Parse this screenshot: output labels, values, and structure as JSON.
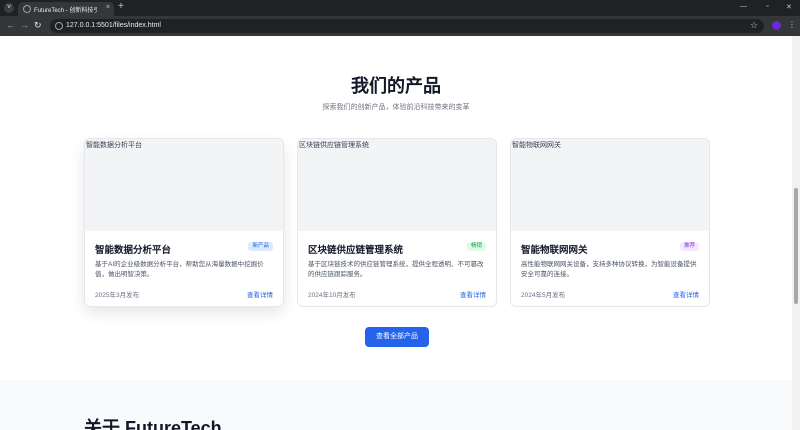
{
  "browser": {
    "tab_title": "FutureTech - 创新科技引领未来",
    "tab_close": "×",
    "new_tab": "+",
    "url": "127.0.0.1:5501/files/index.html",
    "back": "←",
    "forward": "→",
    "reload": "↻",
    "star": "☆",
    "menu": "⋮",
    "tab_menu": "˅",
    "minimize": "—",
    "maximize": "▫",
    "close": "✕"
  },
  "products": {
    "title": "我们的产品",
    "subtitle": "探索我们的创新产品，体验前沿科技带来的变革",
    "cards": [
      {
        "image_alt": "智能数据分析平台",
        "name": "智能数据分析平台",
        "badge": "新产品",
        "badge_color": "#2563eb",
        "badge_bg": "#dbeafe",
        "description": "基于AI的企业级数据分析平台，帮助您从海量数据中挖掘价值，做出明智决策。",
        "date": "2025年3月发布",
        "link": "查看详情"
      },
      {
        "image_alt": "区块链供应链管理系统",
        "name": "区块链供应链管理系统",
        "badge": "畅销",
        "badge_color": "#16a34a",
        "badge_bg": "#dcfce7",
        "description": "基于区块链技术的供应链管理系统，提供全程透明、不可篡改的供应链跟踪服务。",
        "date": "2024年10月发布",
        "link": "查看详情"
      },
      {
        "image_alt": "智能物联网网关",
        "name": "智能物联网网关",
        "badge": "推荐",
        "badge_color": "#9333ea",
        "badge_bg": "#f3e8ff",
        "description": "高性能物联网网关设备，支持多种协议转换，为智能设备提供安全可靠的连接。",
        "date": "2024年5月发布",
        "link": "查看详情"
      }
    ],
    "cta_label": "查看全部产品"
  },
  "about": {
    "title": "关于 FutureTech"
  }
}
